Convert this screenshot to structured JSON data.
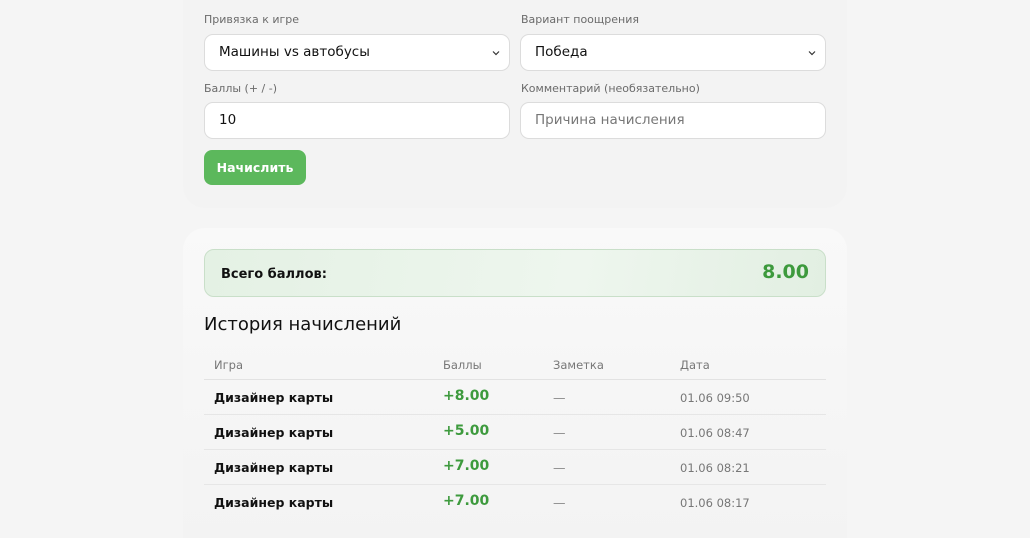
{
  "form": {
    "game_label": "Привязка к игре",
    "game_value": "Машины vs автобусы",
    "reward_label": "Вариант поощрения",
    "reward_value": "Победа",
    "points_label": "Баллы (+ / -)",
    "points_value": "10",
    "comment_label": "Комментарий (необязательно)",
    "comment_placeholder": "Причина начисления",
    "submit_label": "Начислить"
  },
  "summary": {
    "total_label": "Всего баллов:",
    "total_value": "8.00"
  },
  "history": {
    "title": "История начислений",
    "columns": [
      "Игра",
      "Баллы",
      "Заметка",
      "Дата"
    ],
    "rows": [
      {
        "game": "Дизайнер карты",
        "points": "+8.00",
        "note": "—",
        "date": "01.06 09:50"
      },
      {
        "game": "Дизайнер карты",
        "points": "+5.00",
        "note": "—",
        "date": "01.06 08:47"
      },
      {
        "game": "Дизайнер карты",
        "points": "+7.00",
        "note": "—",
        "date": "01.06 08:21"
      },
      {
        "game": "Дизайнер карты",
        "points": "+7.00",
        "note": "—",
        "date": "01.06 08:17"
      }
    ]
  },
  "colors": {
    "accent_green": "#5cb85c",
    "points_green": "#3d9a3d"
  },
  "icons": {
    "select_arrow": "chevron-down-icon"
  }
}
